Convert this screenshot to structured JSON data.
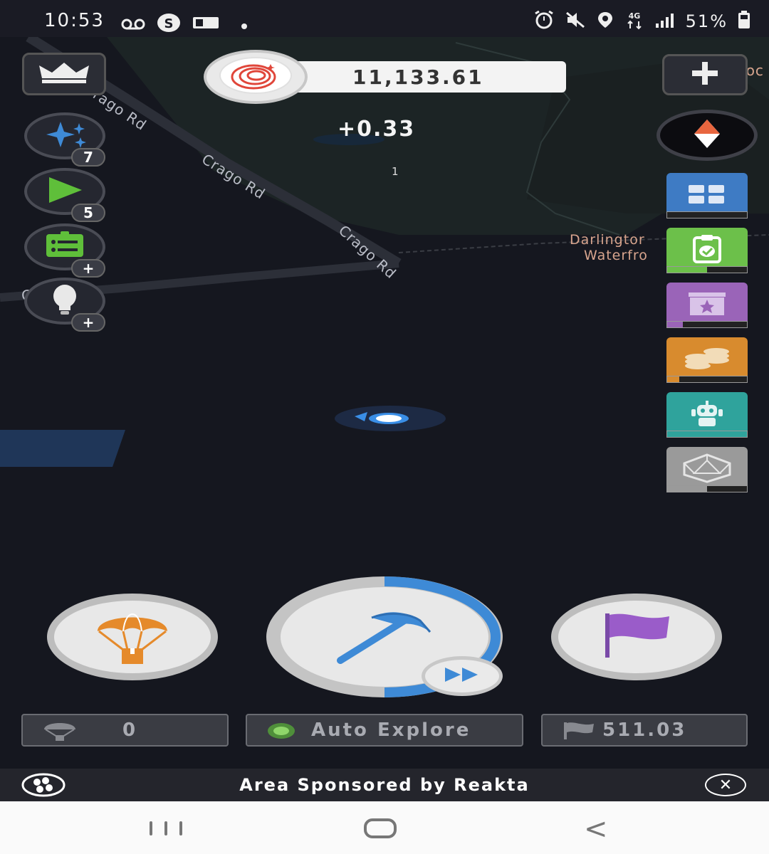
{
  "status_bar": {
    "time": "10:53",
    "left_icons": [
      "voicemail-icon",
      "s-icon",
      "card-icon",
      "dot-icon"
    ],
    "right_icons": [
      "alarm-icon",
      "mute-icon",
      "location-icon",
      "4g-icon",
      "signal-icon"
    ],
    "network": "4G",
    "battery": "51%"
  },
  "map": {
    "road_labels": [
      "Crago Rd",
      "Crago Rd",
      "Crago Rd",
      "Crago Rd"
    ],
    "poi_label_line1": "Darlingtor",
    "poi_label_line2": "Waterfro",
    "edge_text": "Soc"
  },
  "left_buttons": {
    "leaderboard_icon": "crown-icon",
    "boosts_count": "7",
    "videos_count": "5",
    "tasks_badge": "+",
    "ideas_badge": "+"
  },
  "balance": {
    "value": "11,133.61",
    "delta": "+0.33",
    "small_counter": "1"
  },
  "right_column": {
    "add_icon": "plus-icon",
    "compass_icon": "compass-icon",
    "tiles": [
      {
        "name": "tile-grid",
        "icon": "grid-icon",
        "color": "#3e7bc4",
        "progress": 0
      },
      {
        "name": "tile-checklist",
        "icon": "clipboard-check-icon",
        "color": "#6cc04a",
        "progress": 0.5
      },
      {
        "name": "tile-collection",
        "icon": "star-box-icon",
        "color": "#9a64b8",
        "progress": 0.2
      },
      {
        "name": "tile-coins",
        "icon": "coins-icon",
        "color": "#d88b2e",
        "progress": 0.15
      },
      {
        "name": "tile-robot",
        "icon": "robot-icon",
        "color": "#2fa39c",
        "progress": 1
      },
      {
        "name": "tile-dice",
        "icon": "d20-icon",
        "color": "#9a9a9a",
        "progress": 0.5
      }
    ]
  },
  "actions": {
    "airdrop_icon": "parachute-icon",
    "mine_icon": "pickaxe-icon",
    "mine_progress": 0.5,
    "fast_forward_icon": "fast-forward-icon",
    "flag_icon": "flag-icon"
  },
  "info_bars": {
    "airdrops_count": "0",
    "auto_explore_label": "Auto Explore",
    "flag_value": "511.03"
  },
  "sponsor": {
    "text": "Area Sponsored by Reakta"
  },
  "colors": {
    "map_bg": "#15171f",
    "accent_blue": "#3e8ad6",
    "airdrop_orange": "#e58a2b",
    "flag_purple": "#9a5cc9"
  }
}
